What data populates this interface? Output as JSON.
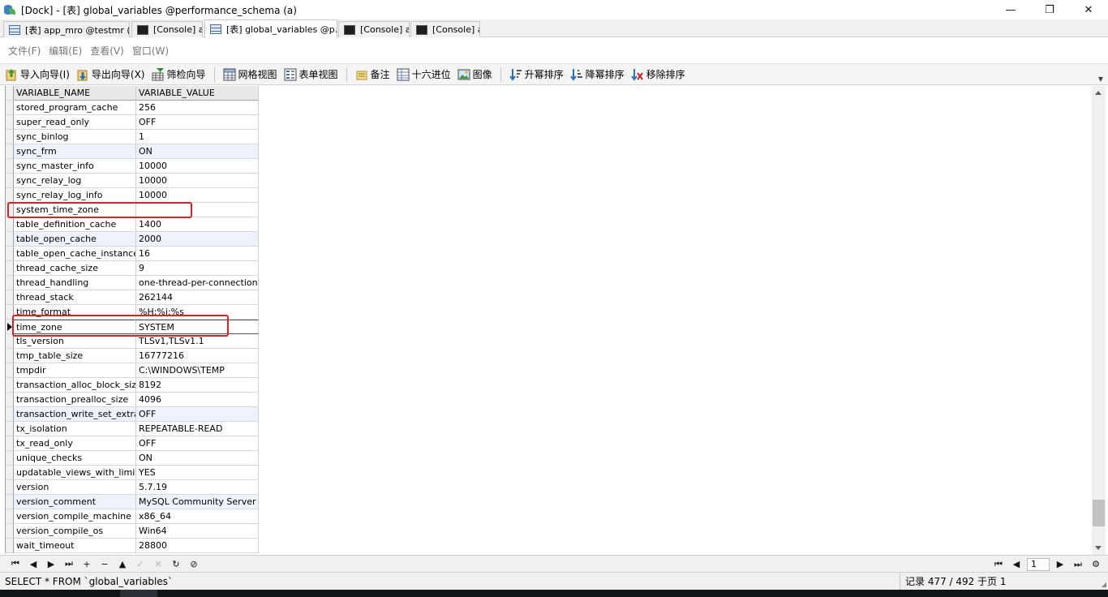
{
  "window": {
    "title": "[Dock] - [表] global_variables @performance_schema (a)",
    "minimize": "—",
    "restore": "❐",
    "close": "✕"
  },
  "tabs": [
    {
      "label": "[表] app_mro @testmr (a)",
      "icon": "table-icon"
    },
    {
      "label": "[Console] a",
      "icon": "console-icon"
    },
    {
      "label": "[表] global_variables @p...",
      "icon": "table-icon",
      "active": true
    },
    {
      "label": "[Console] a",
      "icon": "console-icon"
    },
    {
      "label": "[Console] a",
      "icon": "console-icon"
    }
  ],
  "menu": [
    "文件(F)",
    "编辑(E)",
    "查看(V)",
    "窗口(W)"
  ],
  "toolbar": {
    "import": "导入向导(I)",
    "export": "导出向导(X)",
    "filter": "筛检向导",
    "grid_view": "网格视图",
    "form_view": "表单视图",
    "memo": "备注",
    "hex": "十六进位",
    "image": "图像",
    "sort_asc": "升幂排序",
    "sort_desc": "降幂排序",
    "remove_sort": "移除排序"
  },
  "grid": {
    "columns": [
      "VARIABLE_NAME",
      "VARIABLE_VALUE"
    ],
    "rows": [
      {
        "name": "stored_program_cache",
        "value": "256"
      },
      {
        "name": "super_read_only",
        "value": "OFF"
      },
      {
        "name": "sync_binlog",
        "value": "1"
      },
      {
        "name": "sync_frm",
        "value": "ON"
      },
      {
        "name": "sync_master_info",
        "value": "10000"
      },
      {
        "name": "sync_relay_log",
        "value": "10000"
      },
      {
        "name": "sync_relay_log_info",
        "value": "10000"
      },
      {
        "name": "system_time_zone",
        "value": ""
      },
      {
        "name": "table_definition_cache",
        "value": "1400"
      },
      {
        "name": "table_open_cache",
        "value": "2000"
      },
      {
        "name": "table_open_cache_instances",
        "value": "16"
      },
      {
        "name": "thread_cache_size",
        "value": "9"
      },
      {
        "name": "thread_handling",
        "value": "one-thread-per-connection"
      },
      {
        "name": "thread_stack",
        "value": "262144"
      },
      {
        "name": "time_format",
        "value": "%H:%i:%s"
      },
      {
        "name": "time_zone",
        "value": "SYSTEM"
      },
      {
        "name": "tls_version",
        "value": "TLSv1,TLSv1.1"
      },
      {
        "name": "tmp_table_size",
        "value": "16777216"
      },
      {
        "name": "tmpdir",
        "value": "C:\\WINDOWS\\TEMP"
      },
      {
        "name": "transaction_alloc_block_size",
        "value": "8192"
      },
      {
        "name": "transaction_prealloc_size",
        "value": "4096"
      },
      {
        "name": "transaction_write_set_extraction",
        "value": "OFF"
      },
      {
        "name": "tx_isolation",
        "value": "REPEATABLE-READ"
      },
      {
        "name": "tx_read_only",
        "value": "OFF"
      },
      {
        "name": "unique_checks",
        "value": "ON"
      },
      {
        "name": "updatable_views_with_limit",
        "value": "YES"
      },
      {
        "name": "version",
        "value": "5.7.19"
      },
      {
        "name": "version_comment",
        "value": "MySQL Community Server (GPL)"
      },
      {
        "name": "version_compile_machine",
        "value": "x86_64"
      },
      {
        "name": "version_compile_os",
        "value": "Win64"
      },
      {
        "name": "wait_timeout",
        "value": "28800"
      }
    ],
    "current_row": 15,
    "alt_rows": [
      3,
      9,
      21,
      27
    ],
    "highlight_color": "#e02020"
  },
  "nav": {
    "first": "⏮",
    "prev": "◀",
    "next": "▶",
    "last": "⏭",
    "add": "+",
    "delete": "−",
    "up": "▲",
    "apply": "✓",
    "cancel": "✕",
    "refresh": "↻",
    "stop": "⊘",
    "page": "1"
  },
  "status": {
    "sql": "SELECT * FROM `global_variables`",
    "record": "记录 477 / 492 于页 1"
  }
}
